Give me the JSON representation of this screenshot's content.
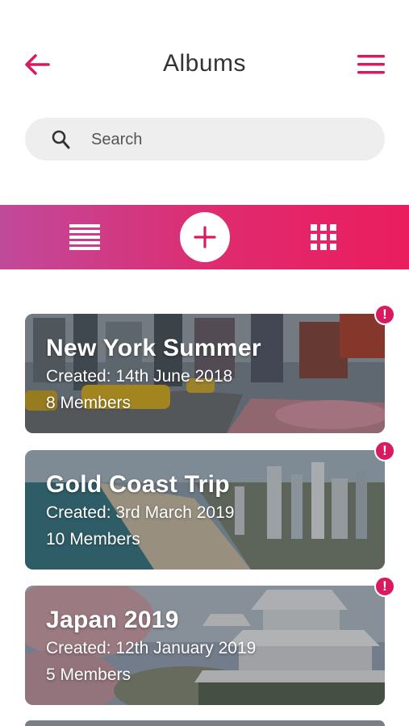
{
  "header": {
    "title": "Albums",
    "back_icon": "arrow-left-icon",
    "menu_icon": "hamburger-menu-icon"
  },
  "search": {
    "placeholder": "Search",
    "icon": "search-icon"
  },
  "toolbar": {
    "list_icon": "list-view-icon",
    "add_icon": "plus-icon",
    "grid_icon": "grid-view-icon"
  },
  "albums": [
    {
      "title": "New York Summer",
      "created": "Created: 14th June 2018",
      "members": "8 Members",
      "alert": "!"
    },
    {
      "title": "Gold Coast Trip",
      "created": "Created: 3rd March 2019",
      "members": "10 Members",
      "alert": "!"
    },
    {
      "title": "Japan 2019",
      "created": "Created: 12th January 2019",
      "members": "5 Members",
      "alert": "!"
    }
  ],
  "colors": {
    "accent": "#d81b60",
    "gradient_start": "#c04a9a",
    "gradient_end": "#ea1d5e",
    "search_bg": "#eeeeee",
    "title_text": "#333333"
  }
}
